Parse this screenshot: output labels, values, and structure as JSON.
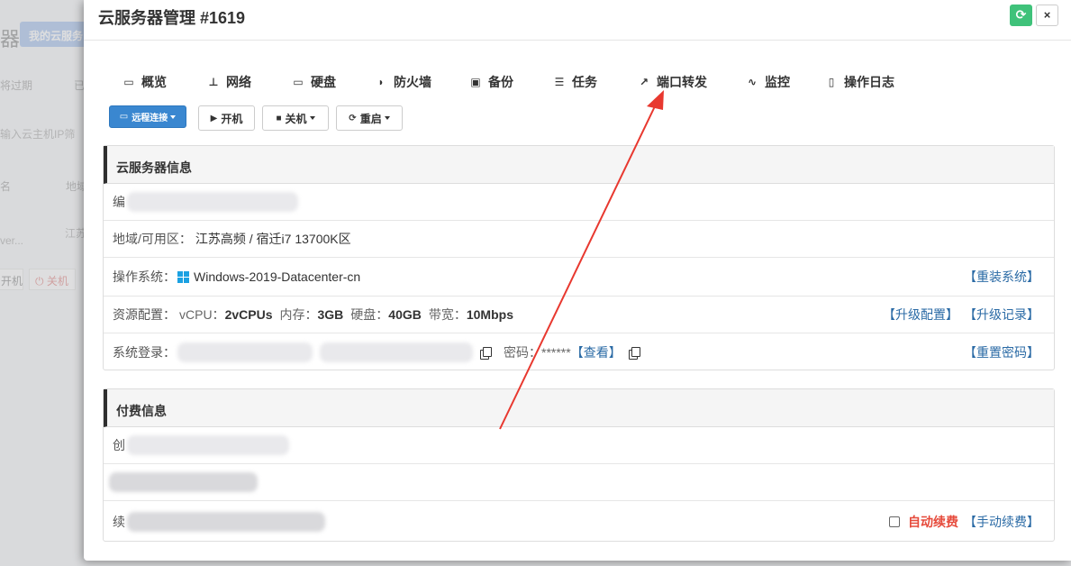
{
  "background": {
    "title_fragment": "器",
    "tab_button": "我的云服务",
    "filter1": "将过期",
    "filter2": "已",
    "search_placeholder": "输入云主机IP筛",
    "col_name": "名",
    "col_region": "地域",
    "cell_server": "ver...",
    "cell_region": "江苏",
    "btn_on": "开机",
    "btn_off": "关机"
  },
  "modal": {
    "title": "云服务器管理 #1619",
    "refresh_icon": "refresh-icon",
    "close_symbol": "×"
  },
  "tabs": [
    {
      "label": "概览",
      "icon": "monitor-icon"
    },
    {
      "label": "网络",
      "icon": "network-icon"
    },
    {
      "label": "硬盘",
      "icon": "disk-icon"
    },
    {
      "label": "防火墙",
      "icon": "shield-icon"
    },
    {
      "label": "备份",
      "icon": "save-icon"
    },
    {
      "label": "任务",
      "icon": "tasks-icon"
    },
    {
      "label": "端口转发",
      "icon": "external-link-icon"
    },
    {
      "label": "监控",
      "icon": "pulse-icon"
    },
    {
      "label": "操作日志",
      "icon": "file-icon"
    }
  ],
  "actions": {
    "remote": "远程连接",
    "power_on": "开机",
    "power_off": "关机",
    "restart": "重启"
  },
  "info_panel": {
    "title": "云服务器信息",
    "id_label_prefix": "编",
    "region_label": "地域/可用区：",
    "region_value": "江苏高频 / 宿迁i7 13700K区",
    "os_label": "操作系统：",
    "os_value": "Windows-2019-Datacenter-cn",
    "os_action": "【重装系统】",
    "res_label": "资源配置：",
    "vcpu_label": "vCPU：",
    "vcpu_value": "2vCPUs",
    "mem_label": "内存：",
    "mem_value": "3GB",
    "disk_label": "硬盘：",
    "disk_value": "40GB",
    "bw_label": "带宽：",
    "bw_value": "10Mbps",
    "upgrade_action": "【升级配置】",
    "upgrade_log_action": "【升级记录】",
    "login_label": "系统登录：",
    "pwd_label": "密码：",
    "pwd_value": "******",
    "view_action": "【查看】",
    "reset_pwd_action": "【重置密码】"
  },
  "pay_panel": {
    "title": "付费信息",
    "row1_prefix": "创",
    "renew_prefix": "续",
    "auto_renew": "自动续费",
    "manual_renew": "【手动续费】"
  },
  "colors": {
    "accent": "#3a87d0",
    "refresh": "#3fc27a",
    "arrow": "#e8382f",
    "link": "#2a6aa5"
  }
}
